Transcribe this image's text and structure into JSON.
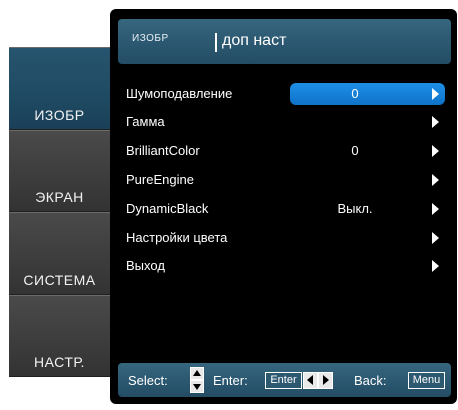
{
  "title": {
    "section": "ИЗОБР",
    "page": "доп наст"
  },
  "tabs": [
    {
      "label": "ИЗОБР",
      "active": true
    },
    {
      "label": "ЭКРАН",
      "active": false
    },
    {
      "label": "СИСТЕМА",
      "active": false
    },
    {
      "label": "НАСТР.",
      "active": false
    }
  ],
  "menu": [
    {
      "label": "Шумоподавление",
      "value": "0",
      "selected": true
    },
    {
      "label": "Гамма",
      "value": ""
    },
    {
      "label": "BrilliantColor",
      "value": "0"
    },
    {
      "label": "PureEngine",
      "value": ""
    },
    {
      "label": "DynamicBlack",
      "value": "Выкл."
    },
    {
      "label": "Настройки цвета",
      "value": ""
    },
    {
      "label": "Выход",
      "value": ""
    }
  ],
  "footer": {
    "select_label": "Select:",
    "enter_label": "Enter:",
    "enter_key": "Enter",
    "back_label": "Back:",
    "back_key": "Menu"
  },
  "colors": {
    "accent": "#1e8fe6",
    "panel": "#2a566f",
    "active_tab": "#1f4a63",
    "inactive_tab": "#3c3c3c"
  }
}
